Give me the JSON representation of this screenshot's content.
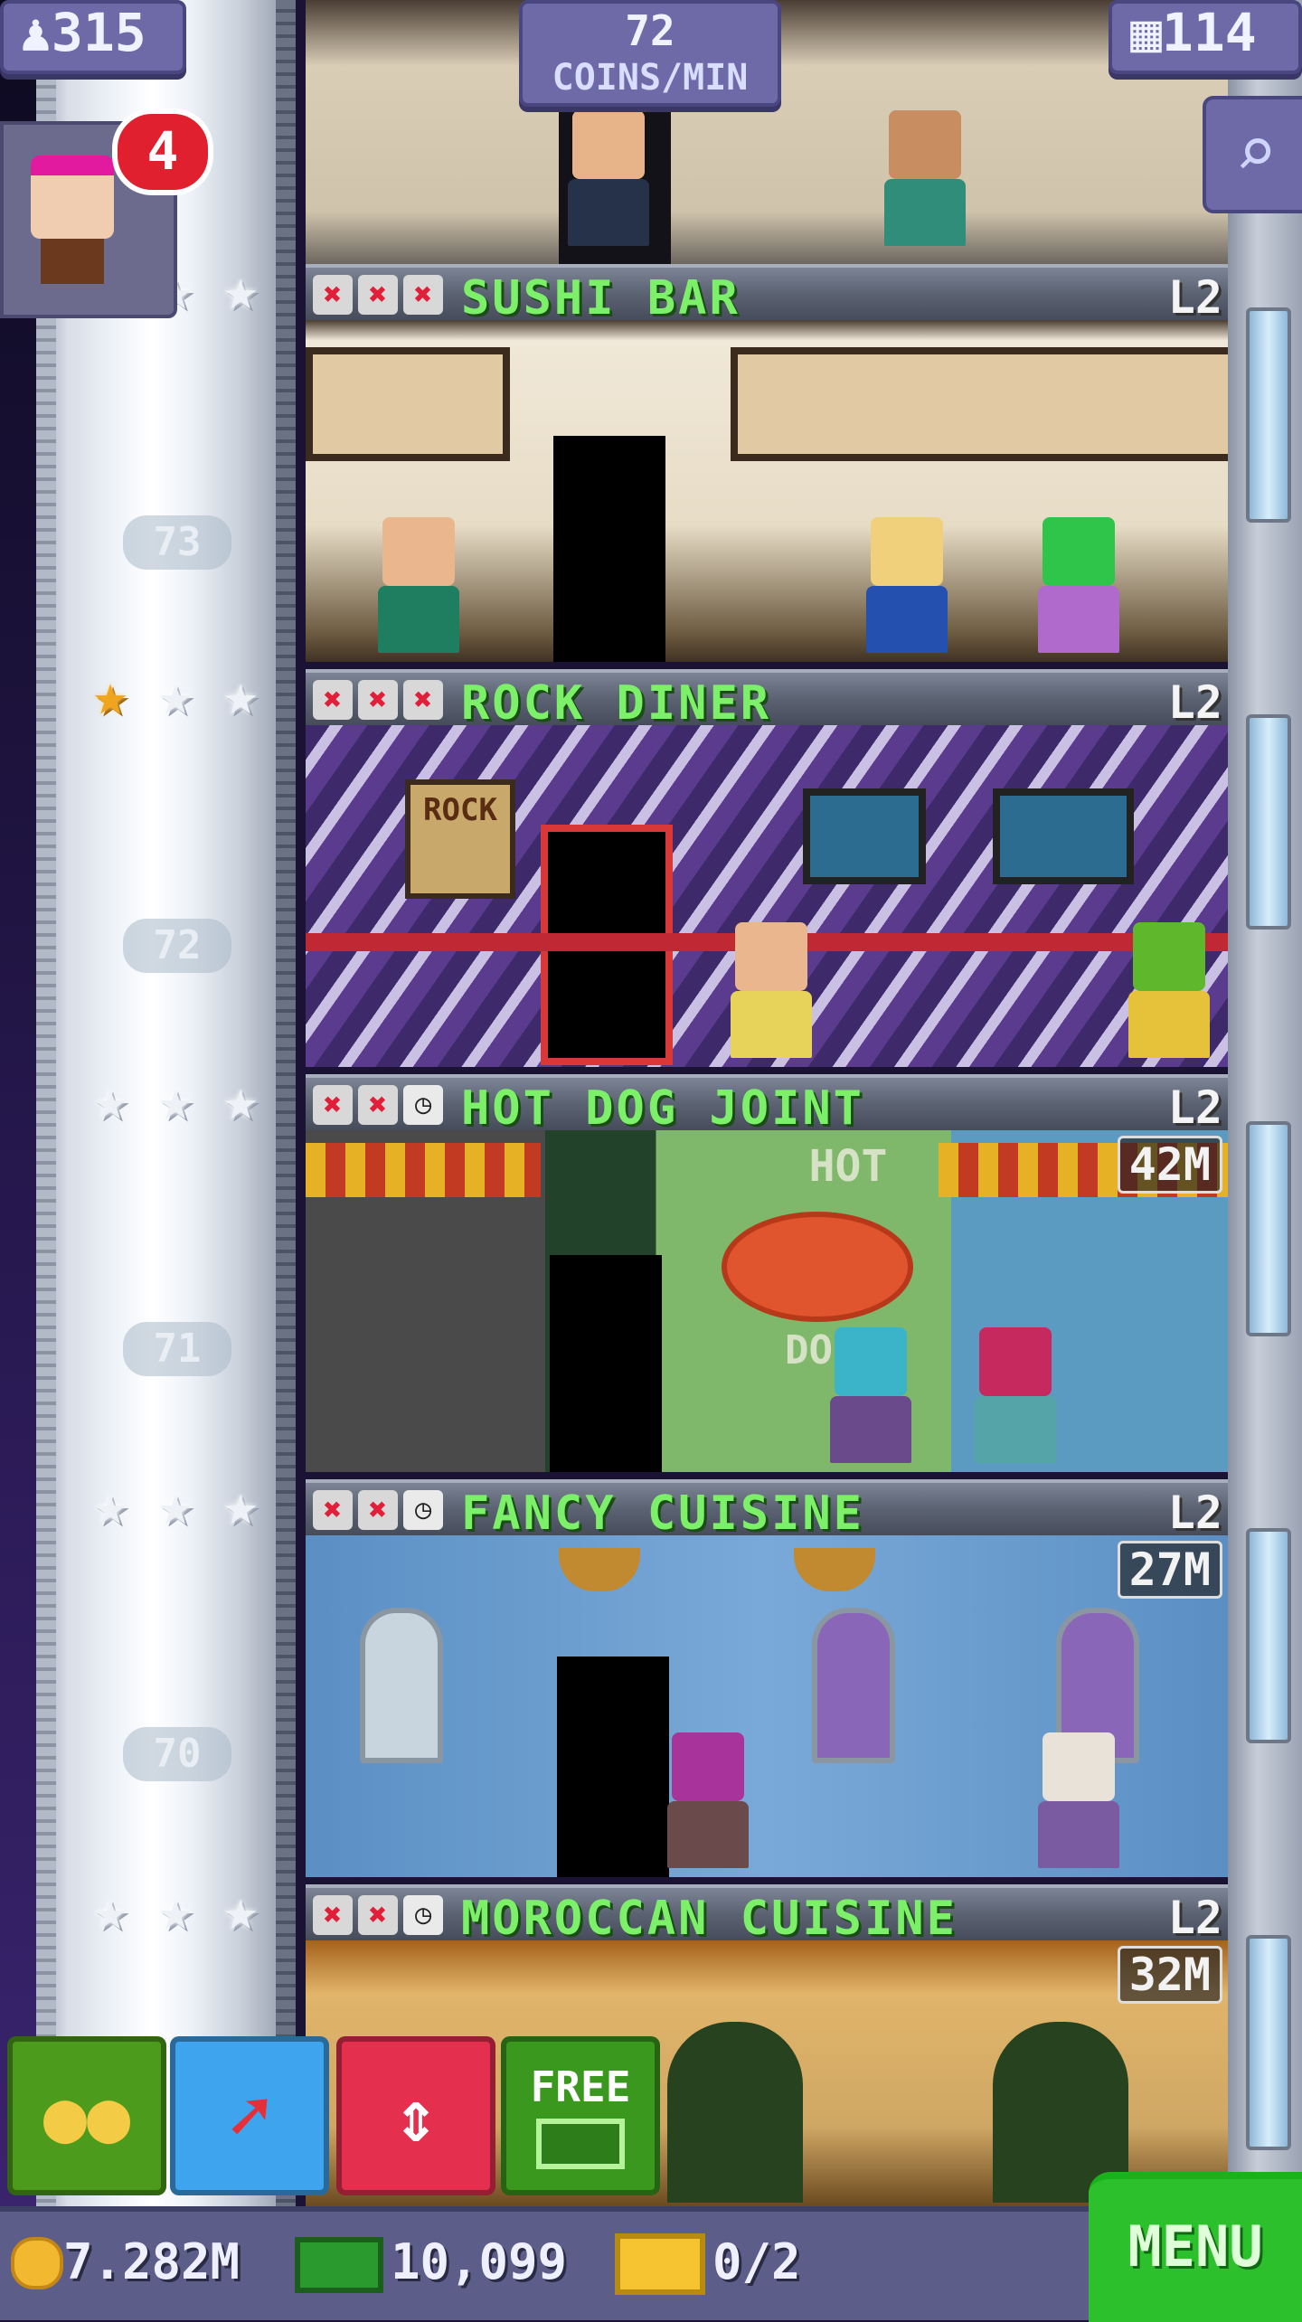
{
  "hud": {
    "population": "315",
    "coins_per_min": "72",
    "coins_per_min_label": "COINS/MIN",
    "floor_count": "114",
    "notification_count": "4"
  },
  "floors": [
    {
      "number": "73",
      "name": "SUSHI BAR",
      "level": "L2",
      "timer": "",
      "stars_gold": 0,
      "status": [
        "x",
        "x",
        "x"
      ]
    },
    {
      "number": "72",
      "name": "ROCK DINER",
      "level": "L2",
      "timer": "",
      "stars_gold": 1,
      "status": [
        "x",
        "x",
        "x"
      ]
    },
    {
      "number": "71",
      "name": "HOT DOG JOINT",
      "level": "L2",
      "timer": "42M",
      "stars_gold": 0,
      "status": [
        "x",
        "x",
        "clock"
      ]
    },
    {
      "number": "70",
      "name": "FANCY CUISINE",
      "level": "L2",
      "timer": "27M",
      "stars_gold": 0,
      "status": [
        "x",
        "x",
        "clock"
      ]
    },
    {
      "number": "",
      "name": "MOROCCAN CUISINE",
      "level": "L2",
      "timer": "32M",
      "stars_gold": 0,
      "status": [
        "x",
        "x",
        "clock"
      ]
    }
  ],
  "room_signs": {
    "rock": "ROCK",
    "hot": "HOT",
    "do": "DO"
  },
  "actions": {
    "free_label": "FREE"
  },
  "bottom_bar": {
    "coins": "7.282M",
    "bux": "10,099",
    "vip": "0/2",
    "menu_label": "MENU"
  },
  "icons": {
    "stars": "star-icon",
    "status_fail": "x-icon",
    "status_pending": "clock-icon",
    "zoom": "magnifier-icon",
    "floors": "building-icon",
    "population": "person-icon"
  },
  "colors": {
    "floor_name": "#7cf068",
    "hud_purple": "#6e6aa8",
    "badge_red": "#e0202e",
    "menu_green": "#2cc12c"
  }
}
